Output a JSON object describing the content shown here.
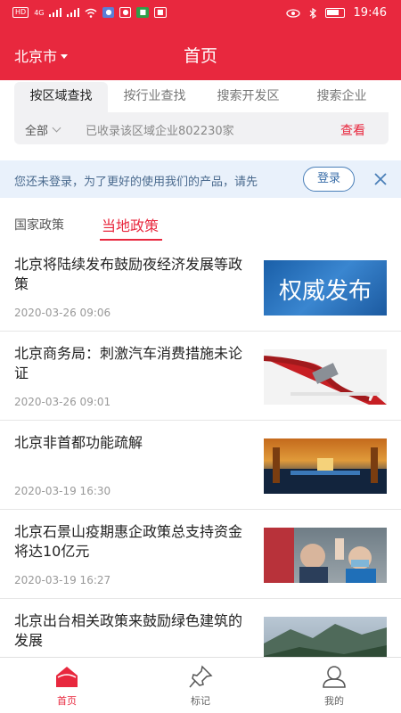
{
  "statusbar": {
    "time": "19:46",
    "network": "4G",
    "hd": "HD"
  },
  "header": {
    "city": "北京市",
    "title": "首页"
  },
  "search_tabs": [
    "按区域查找",
    "按行业查找",
    "搜索开发区",
    "搜索企业"
  ],
  "search": {
    "scope": "全部",
    "count_text": "已收录该区域企业802230家",
    "view_label": "查看"
  },
  "login_bar": {
    "text": "您还未登录，为了更好的使用我们的产品，请先",
    "button": "登录"
  },
  "news_tabs": [
    "国家政策",
    "当地政策"
  ],
  "news": [
    {
      "title": "北京将陆续发布鼓励夜经济发展等政策",
      "date": "2020-03-26 09:06",
      "thumb_text": "权威发布"
    },
    {
      "title": "北京商务局：刺激汽车消费措施未论证",
      "date": "2020-03-26 09:01"
    },
    {
      "title": "北京非首都功能疏解",
      "date": "2020-03-19 16:30"
    },
    {
      "title": "北京石景山疫期惠企政策总支持资金将达10亿元",
      "date": "2020-03-19 16:27"
    },
    {
      "title": "北京出台相关政策来鼓励绿色建筑的发展",
      "date": ""
    }
  ],
  "tabbar": [
    "首页",
    "标记",
    "我的"
  ],
  "colors": {
    "brand": "#e8283e",
    "login_bg": "#e9f1fb"
  }
}
